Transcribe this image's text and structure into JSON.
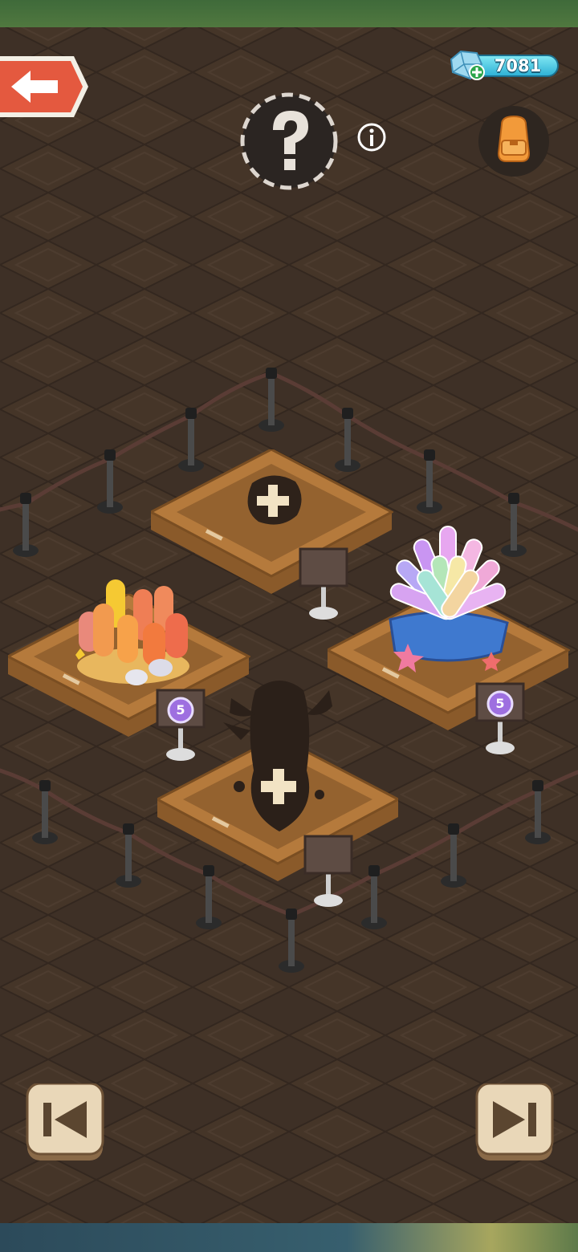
{
  "currency": {
    "gems": "7081",
    "gem_icon": "blue-gem-icon",
    "add_icon": "plus-icon"
  },
  "header": {
    "back_icon": "arrow-left-icon",
    "help_icon": "question-mark-icon",
    "info_icon": "info-icon",
    "backpack_icon": "backpack-icon"
  },
  "exhibits": [
    {
      "slot": "back",
      "state": "empty",
      "icon": "plus-icon"
    },
    {
      "slot": "left",
      "state": "filled",
      "item": "orange-tube-coral",
      "sign_level": "5"
    },
    {
      "slot": "right",
      "state": "filled",
      "item": "rainbow-sea-anemone",
      "sign_level": "5"
    },
    {
      "slot": "front",
      "state": "empty-silhouette",
      "icon": "plus-icon"
    }
  ],
  "navigation": {
    "prev_icon": "skip-previous-icon",
    "next_icon": "skip-next-icon"
  },
  "colors": {
    "floor": "#3e3026",
    "tile_light": "#4a3a2e",
    "plinth_top": "#b57a3c",
    "plinth_side": "#8a5a2a",
    "back_button": "#e4593f",
    "gem_bar": "#2fb2d6",
    "level_badge": "#9e6fe0"
  }
}
